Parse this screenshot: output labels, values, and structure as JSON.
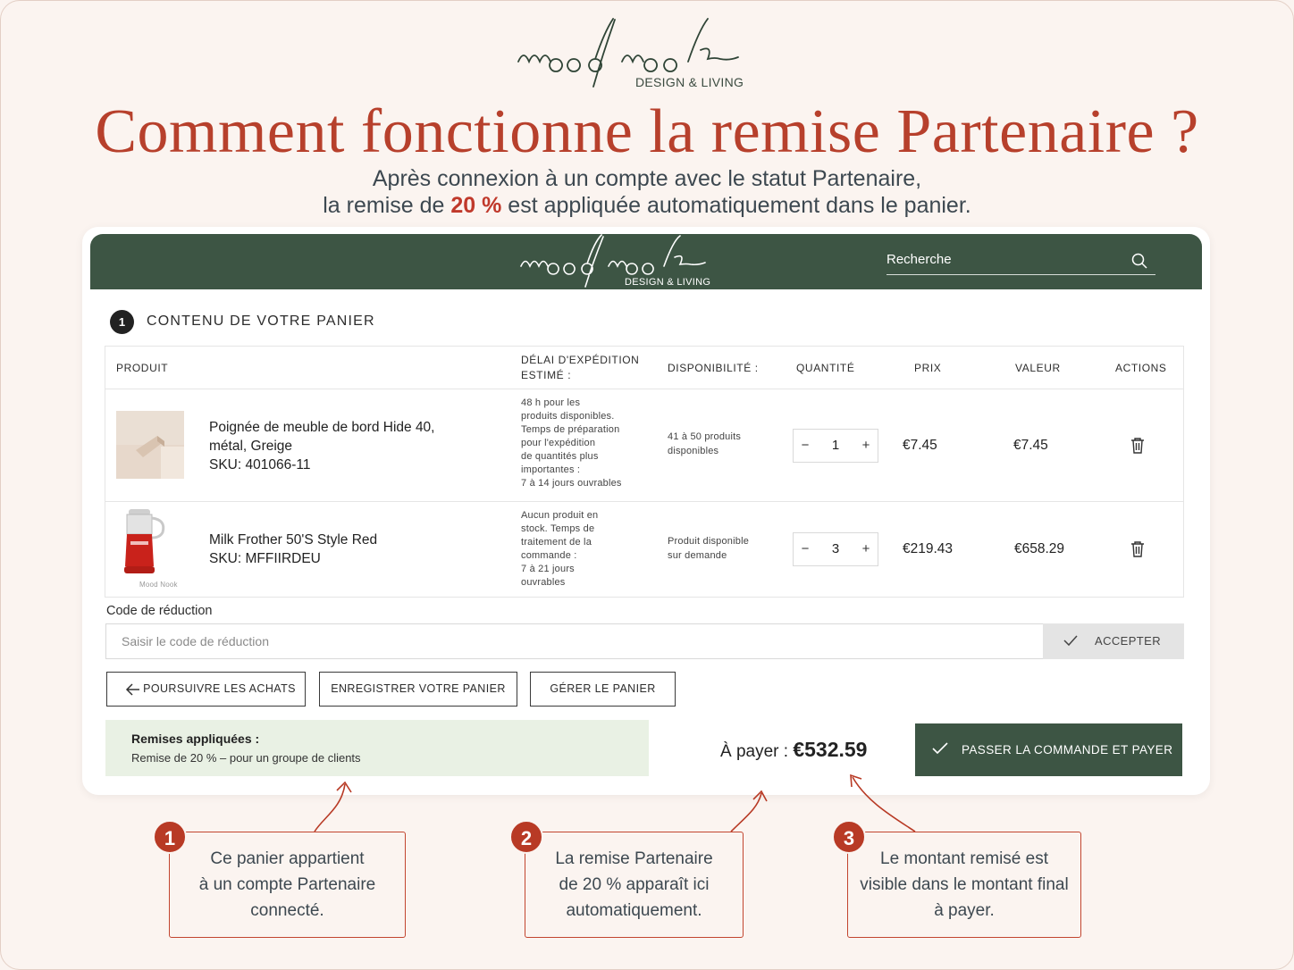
{
  "brand": {
    "logo_text": "moodnook",
    "tagline": "DESIGN & LIVING"
  },
  "headline": "Comment fonctionne la remise Partenaire ?",
  "subtitle": {
    "line1": "Après connexion à un compte avec le statut Partenaire,",
    "line2_before": "la remise de ",
    "line2_highlight": "20 %",
    "line2_after": " est appliquée automatiquement dans le panier."
  },
  "shop_header": {
    "logo_text": "moodnook",
    "tagline": "DESIGN & LIVING",
    "search_placeholder": "Recherche"
  },
  "cart": {
    "step_number": "1",
    "step_title": "CONTENU DE VOTRE PANIER",
    "columns": {
      "product": "PRODUIT",
      "shipping": "DÉLAI D'EXPÉDITION ESTIMÉ :",
      "availability": "DISPONIBILITÉ :",
      "quantity": "QUANTITÉ",
      "price": "PRIX",
      "value": "VALEUR",
      "actions": "ACTIONS"
    },
    "items": [
      {
        "name_line1": "Poignée de meuble de bord Hide 40,",
        "name_line2": "métal, Greige",
        "sku": "SKU: 401066-11",
        "shipping": [
          "48 h pour les",
          "produits disponibles.",
          "Temps de préparation",
          "pour l'expédition",
          "de quantités plus",
          "importantes :",
          "7 à 14 jours ouvrables"
        ],
        "availability": [
          "41 à 50 produits",
          "disponibles"
        ],
        "quantity": "1",
        "price": "€7.45",
        "value": "€7.45"
      },
      {
        "name_line1": "Milk Frother 50'S Style Red",
        "sku": "SKU: MFFIIRDEU",
        "image_caption": "Mood Nook",
        "shipping": [
          "Aucun produit en",
          "stock. Temps de",
          "traitement de la",
          "commande :",
          "7 à 21 jours",
          "ouvrables"
        ],
        "availability": [
          "Produit disponible",
          "sur demande"
        ],
        "quantity": "3",
        "price": "€219.43",
        "value": "€658.29"
      }
    ],
    "qty_minus": "−",
    "qty_plus": "+"
  },
  "discount": {
    "label": "Code de réduction",
    "placeholder": "Saisir le code de réduction",
    "accept_label": "ACCEPTER"
  },
  "buttons": {
    "continue": "POURSUIVRE LES ACHATS",
    "save": "ENREGISTRER VOTRE PANIER",
    "manage": "GÉRER LE PANIER",
    "checkout": "PASSER LA COMMANDE ET PAYER"
  },
  "applied": {
    "title": "Remises appliquées :",
    "detail": "Remise de 20 % – pour un groupe de clients"
  },
  "total": {
    "label": "À payer : ",
    "amount": "€532.59"
  },
  "callouts": [
    {
      "number": "1",
      "lines": [
        "Ce panier appartient",
        "à un compte Partenaire",
        "connecté."
      ]
    },
    {
      "number": "2",
      "lines": [
        "La remise Partenaire",
        "de 20 % apparaît ici",
        "automatiquement."
      ]
    },
    {
      "number": "3",
      "lines": [
        "Le montant remisé est",
        "visible dans le montant final",
        "à payer."
      ]
    }
  ],
  "colors": {
    "accent_red": "#b7402c",
    "brand_green": "#3d5544",
    "applied_bg": "#e9f1e4",
    "page_bg": "#fbf4f0"
  },
  "icons": {
    "search": "search-icon",
    "trash": "trash-icon",
    "check": "check-icon",
    "arrow_left": "arrow-left-icon"
  }
}
